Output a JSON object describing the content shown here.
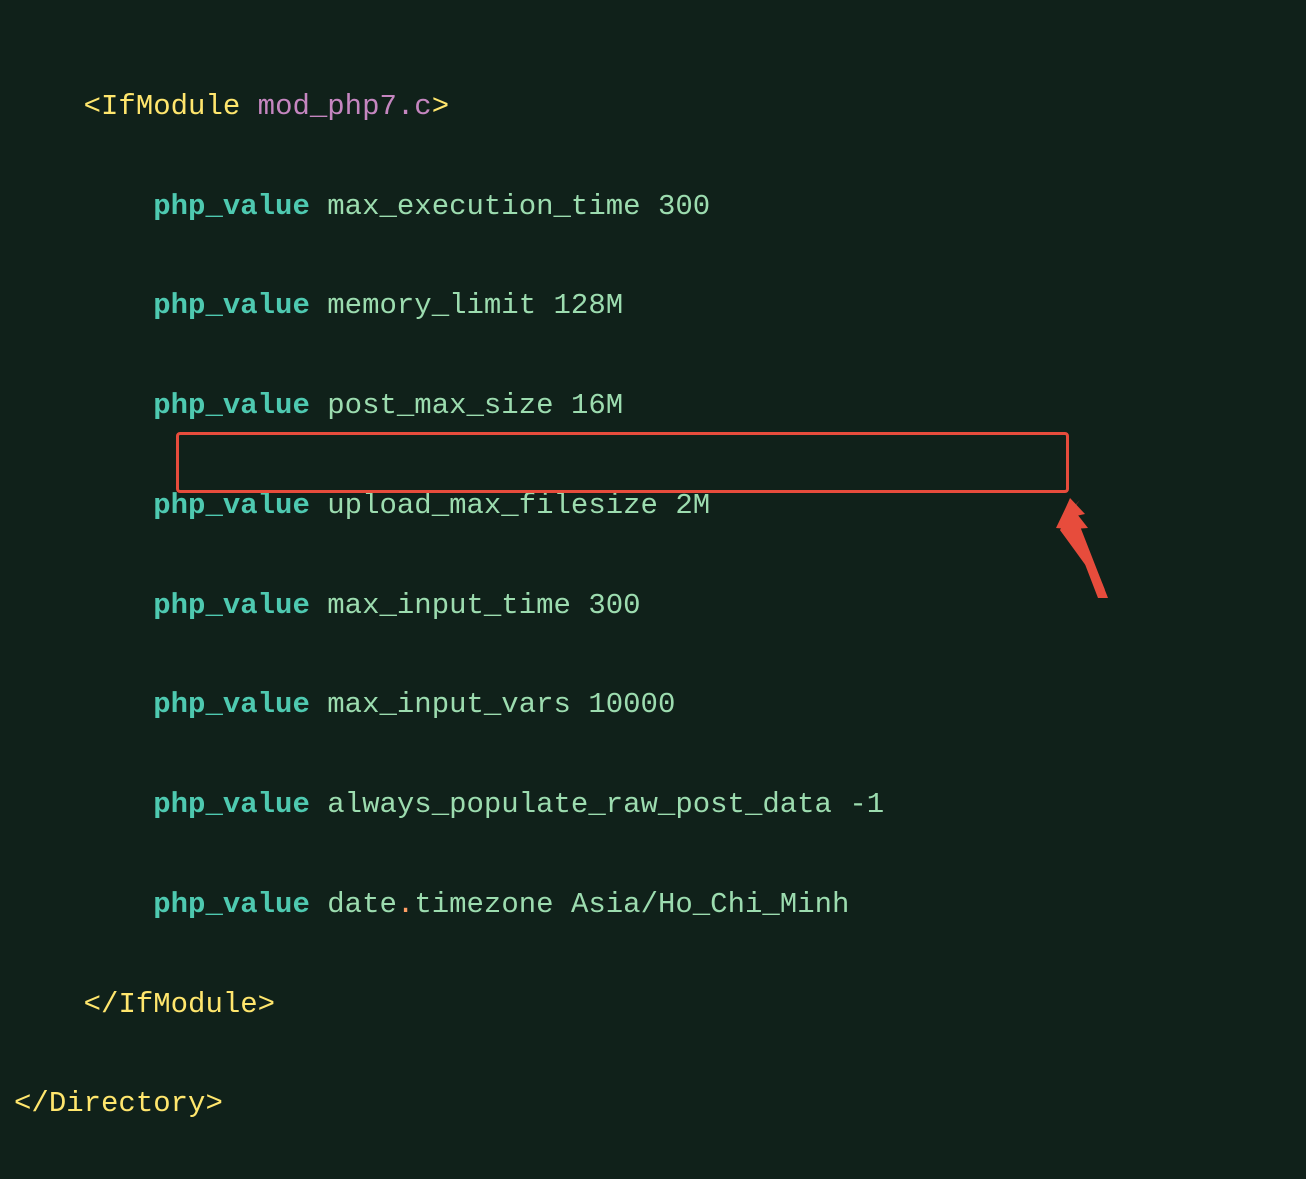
{
  "code": {
    "tag_open_left": "<",
    "tag_ifmodule": "IfModule",
    "attr_mod": "mod_php7.c",
    "tag_open_right": ">",
    "directive": "php_value",
    "max_execution_time": "max_execution_time",
    "max_execution_time_val": "300",
    "memory_limit": "memory_limit",
    "memory_limit_val": "128M",
    "post_max_size": "post_max_size",
    "post_max_size_val": "16M",
    "upload_max_filesize": "upload_max_filesize",
    "upload_max_filesize_val": "2M",
    "max_input_time": "max_input_time",
    "max_input_time_val": "300",
    "max_input_vars": "max_input_vars",
    "max_input_vars_val": "10000",
    "always_populate_raw_post_data": "always_populate_raw_post_data",
    "always_populate_raw_post_data_val": "-1",
    "date": "date",
    "dot": ".",
    "timezone": "timezone",
    "timezone_val": "Asia/Ho_Chi_Minh",
    "close_ifmodule_left": "</",
    "close_ifmodule": "IfModule",
    "close_ifmodule_right": ">",
    "close_directory_left": "</",
    "close_directory": "Directory",
    "close_directory_right": ">"
  }
}
